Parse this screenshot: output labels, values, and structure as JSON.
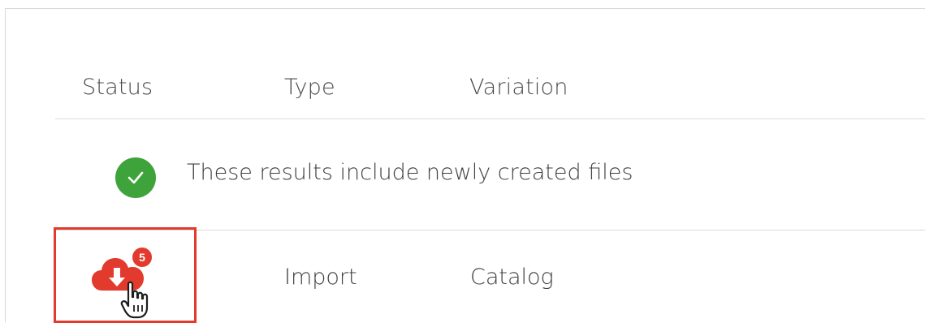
{
  "table": {
    "headers": {
      "status": "Status",
      "type": "Type",
      "variation": "Variation"
    },
    "info_message": {
      "icon": "check-circle-icon",
      "text": "These results include newly created files",
      "color": "#3ea33a"
    },
    "rows": [
      {
        "status_icon": "cloud-download-icon",
        "badge_count": "5",
        "type": "Import",
        "variation": "Catalog",
        "accent_color": "#e23b2e"
      }
    ]
  }
}
